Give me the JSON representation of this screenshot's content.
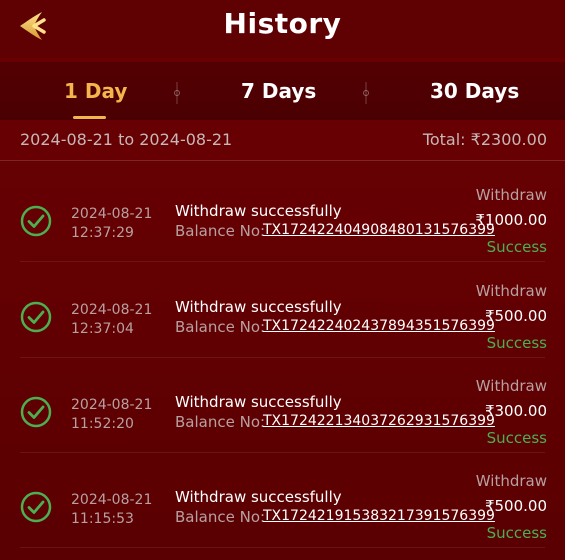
{
  "header": {
    "title": "History",
    "back_icon": "back-arrow-icon"
  },
  "tabs": [
    {
      "label": "1 Day",
      "active": true
    },
    {
      "label": "7 Days",
      "active": false
    },
    {
      "label": "30 Days",
      "active": false
    }
  ],
  "summary": {
    "date_range": "2024-08-21 to 2024-08-21",
    "total": "Total: ₹2300.00"
  },
  "transactions": [
    {
      "date": "2024-08-21",
      "time": "12:37:29",
      "message": "Withdraw successfully",
      "balance_label": "Balance No:",
      "tx_id": "TX172422404908480131576399",
      "type": "Withdraw",
      "amount": "₹1000.00",
      "status": "Success"
    },
    {
      "date": "2024-08-21",
      "time": "12:37:04",
      "message": "Withdraw successfully",
      "balance_label": "Balance No:",
      "tx_id": "TX172422402437894351576399",
      "type": "Withdraw",
      "amount": "₹500.00",
      "status": "Success"
    },
    {
      "date": "2024-08-21",
      "time": "11:52:20",
      "message": "Withdraw successfully",
      "balance_label": "Balance No:",
      "tx_id": "TX172422134037262931576399",
      "type": "Withdraw",
      "amount": "₹300.00",
      "status": "Success"
    },
    {
      "date": "2024-08-21",
      "time": "11:15:53",
      "message": "Withdraw successfully",
      "balance_label": "Balance No:",
      "tx_id": "TX172421915383217391576399",
      "type": "Withdraw",
      "amount": "₹500.00",
      "status": "Success"
    }
  ],
  "colors": {
    "background": "#5a0002",
    "accent": "#f2b64c",
    "success": "#4caf50",
    "muted_text": "#b8a0a0"
  }
}
